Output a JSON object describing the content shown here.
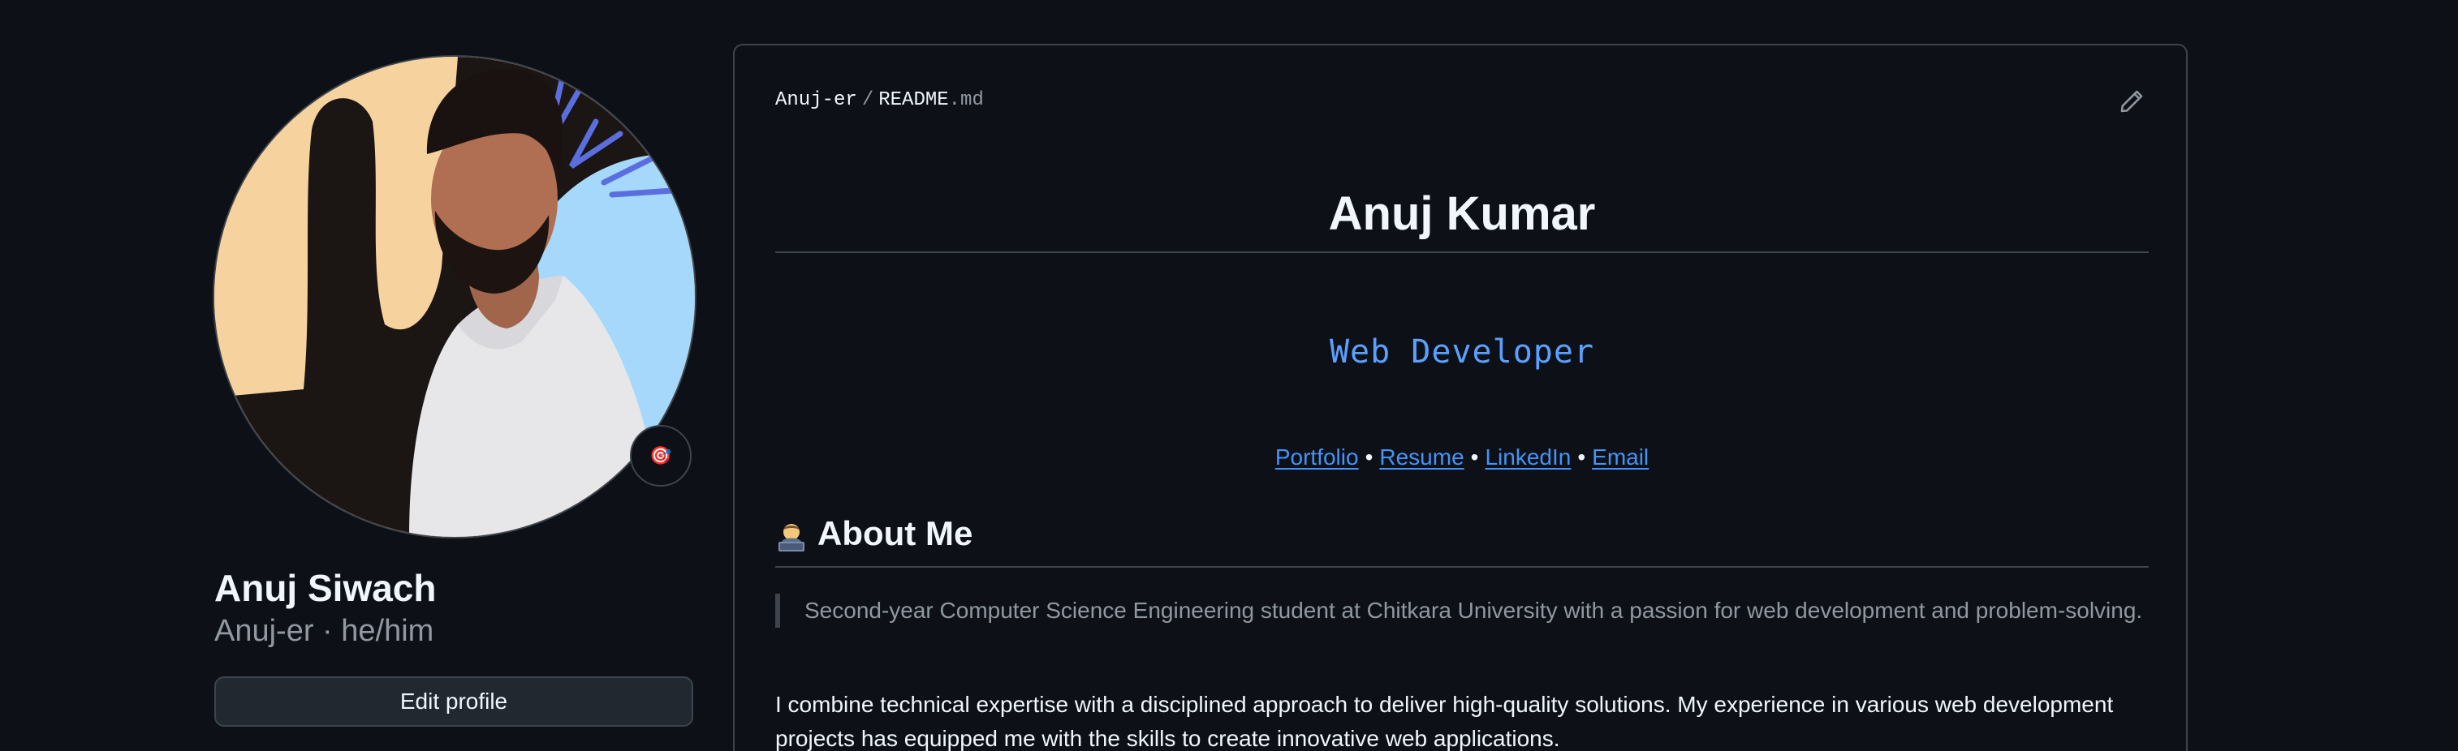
{
  "profile": {
    "name": "Anuj Siwach",
    "username_pronouns": "Anuj-er · he/him",
    "edit_button": "Edit profile",
    "status_emoji": "🎯"
  },
  "readme": {
    "path_owner": "Anuj-er",
    "path_separator": "/",
    "path_file": "README",
    "path_ext": ".md",
    "title": "Anuj Kumar",
    "tagline": "Web Developer",
    "links": {
      "portfolio": "Portfolio",
      "resume": "Resume",
      "linkedin": "LinkedIn",
      "email": "Email",
      "separator": "•"
    },
    "about_heading": "About Me",
    "about_quote": "Second-year Computer Science Engineering student at Chitkara University with a passion for web development and problem-solving.",
    "about_paragraph": "I combine technical expertise with a disciplined approach to deliver high-quality solutions. My experience in various web development projects has equipped me with the skills to create innovative web applications."
  },
  "colors": {
    "background": "#0d1117",
    "border": "#3d444d",
    "link": "#4493f8",
    "tagline": "#5aa0ff",
    "muted": "#9198a1",
    "text": "#f0f6fc"
  },
  "icons": {
    "edit": "pencil-icon",
    "about_emoji": "technologist-emoji-icon"
  }
}
